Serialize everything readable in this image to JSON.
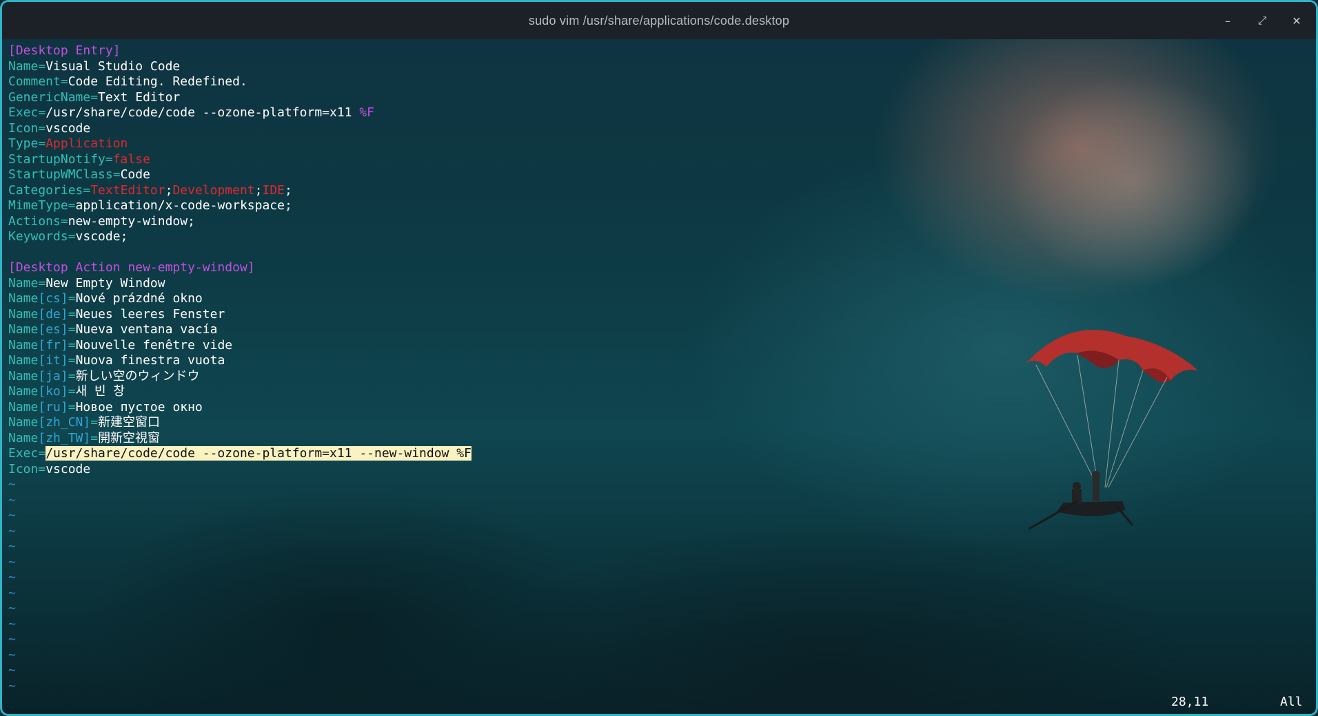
{
  "window": {
    "title": "sudo vim /usr/share/applications/code.desktop",
    "controls": {
      "minimize": "–",
      "maximize": "⤢",
      "close": "✕"
    }
  },
  "file": {
    "lines": [
      [
        {
          "t": "sec",
          "v": "[Desktop Entry]"
        }
      ],
      [
        {
          "t": "key",
          "v": "Name="
        },
        {
          "t": "val",
          "v": "Visual Studio Code"
        }
      ],
      [
        {
          "t": "key",
          "v": "Comment="
        },
        {
          "t": "val",
          "v": "Code Editing. Redefined."
        }
      ],
      [
        {
          "t": "key",
          "v": "GenericName="
        },
        {
          "t": "val",
          "v": "Text Editor"
        }
      ],
      [
        {
          "t": "key",
          "v": "Exec="
        },
        {
          "t": "val",
          "v": "/usr/share/code/code --ozone-platform=x11 "
        },
        {
          "t": "spec",
          "v": "%F"
        }
      ],
      [
        {
          "t": "key",
          "v": "Icon="
        },
        {
          "t": "val",
          "v": "vscode"
        }
      ],
      [
        {
          "t": "key",
          "v": "Type="
        },
        {
          "t": "const",
          "v": "Application"
        }
      ],
      [
        {
          "t": "key",
          "v": "StartupNotify="
        },
        {
          "t": "const",
          "v": "false"
        }
      ],
      [
        {
          "t": "key",
          "v": "StartupWMClass="
        },
        {
          "t": "val",
          "v": "Code"
        }
      ],
      [
        {
          "t": "key",
          "v": "Categories="
        },
        {
          "t": "const",
          "v": "TextEditor"
        },
        {
          "t": "val",
          "v": ";"
        },
        {
          "t": "const",
          "v": "Development"
        },
        {
          "t": "val",
          "v": ";"
        },
        {
          "t": "const",
          "v": "IDE"
        },
        {
          "t": "val",
          "v": ";"
        }
      ],
      [
        {
          "t": "key",
          "v": "MimeType="
        },
        {
          "t": "val",
          "v": "application/x-code-workspace;"
        }
      ],
      [
        {
          "t": "key",
          "v": "Actions="
        },
        {
          "t": "val",
          "v": "new-empty-window;"
        }
      ],
      [
        {
          "t": "key",
          "v": "Keywords="
        },
        {
          "t": "val",
          "v": "vscode;"
        }
      ],
      [],
      [
        {
          "t": "sec",
          "v": "[Desktop Action new-empty-window]"
        }
      ],
      [
        {
          "t": "key",
          "v": "Name="
        },
        {
          "t": "val",
          "v": "New Empty Window"
        }
      ],
      [
        {
          "t": "key",
          "v": "Name"
        },
        {
          "t": "lang",
          "v": "[cs]"
        },
        {
          "t": "key",
          "v": "="
        },
        {
          "t": "val",
          "v": "Nové prázdné okno"
        }
      ],
      [
        {
          "t": "key",
          "v": "Name"
        },
        {
          "t": "lang",
          "v": "[de]"
        },
        {
          "t": "key",
          "v": "="
        },
        {
          "t": "val",
          "v": "Neues leeres Fenster"
        }
      ],
      [
        {
          "t": "key",
          "v": "Name"
        },
        {
          "t": "lang",
          "v": "[es]"
        },
        {
          "t": "key",
          "v": "="
        },
        {
          "t": "val",
          "v": "Nueva ventana vacía"
        }
      ],
      [
        {
          "t": "key",
          "v": "Name"
        },
        {
          "t": "lang",
          "v": "[fr]"
        },
        {
          "t": "key",
          "v": "="
        },
        {
          "t": "val",
          "v": "Nouvelle fenêtre vide"
        }
      ],
      [
        {
          "t": "key",
          "v": "Name"
        },
        {
          "t": "lang",
          "v": "[it]"
        },
        {
          "t": "key",
          "v": "="
        },
        {
          "t": "val",
          "v": "Nuova finestra vuota"
        }
      ],
      [
        {
          "t": "key",
          "v": "Name"
        },
        {
          "t": "lang",
          "v": "[ja]"
        },
        {
          "t": "key",
          "v": "="
        },
        {
          "t": "val",
          "v": "新しい空のウィンドウ"
        }
      ],
      [
        {
          "t": "key",
          "v": "Name"
        },
        {
          "t": "lang",
          "v": "[ko]"
        },
        {
          "t": "key",
          "v": "="
        },
        {
          "t": "val",
          "v": "새 빈 창"
        }
      ],
      [
        {
          "t": "key",
          "v": "Name"
        },
        {
          "t": "lang",
          "v": "[ru]"
        },
        {
          "t": "key",
          "v": "="
        },
        {
          "t": "val",
          "v": "Новое пустое окно"
        }
      ],
      [
        {
          "t": "key",
          "v": "Name"
        },
        {
          "t": "lang",
          "v": "[zh_CN]"
        },
        {
          "t": "key",
          "v": "="
        },
        {
          "t": "val",
          "v": "新建空窗口"
        }
      ],
      [
        {
          "t": "key",
          "v": "Name"
        },
        {
          "t": "lang",
          "v": "[zh_TW]"
        },
        {
          "t": "key",
          "v": "="
        },
        {
          "t": "val",
          "v": "開新空視窗"
        }
      ],
      [
        {
          "t": "key",
          "v": "Exec="
        },
        {
          "t": "hl",
          "v": "/usr/share/code/code --ozone-platform=x11 --new-window %F"
        }
      ],
      [
        {
          "t": "key",
          "v": "Icon="
        },
        {
          "t": "val",
          "v": "vscode"
        }
      ]
    ],
    "empty_line_marker": "~",
    "empty_line_count": 14
  },
  "statusline": {
    "cursor_position": "28,11",
    "scroll_position": "All"
  },
  "colors": {
    "section": "#c64ee0",
    "key": "#2fc0b4",
    "locale": "#2aa8d8",
    "constant": "#e0282c",
    "text": "#ffffff",
    "highlight_bg": "#fbf2c2",
    "tilde": "#3a86c8",
    "border": "#2fb4c8",
    "titlebar": "#1c2128"
  }
}
